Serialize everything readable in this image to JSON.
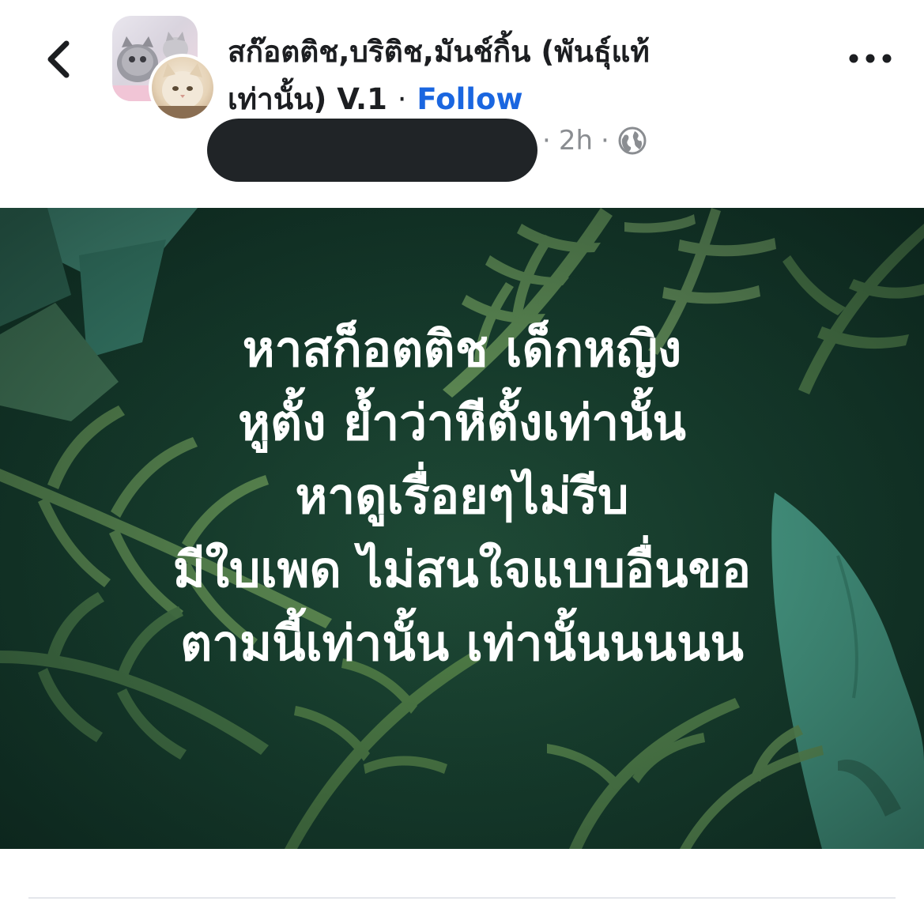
{
  "header": {
    "back_icon": "chevron-left-icon",
    "group_name": "สก๊อตติช,บริติช,มันช์กิ้น (พันธุ์แท้เท่านั้น) V.1",
    "separator": "·",
    "follow_label": "Follow",
    "more_icon": "more-horizontal-icon"
  },
  "post": {
    "time": "2h",
    "meta_separator": "·",
    "audience_icon": "globe-icon",
    "text_lines": [
      "หาสก็อตติช เด็กหญิง",
      "หูตั้ง ย้ำว่าหีตั้งเท่านั้น",
      "หาดูเรื่อยๆไม่รีบ",
      "มีใบเพด ไม่สนใจแบบอื่นขอ",
      "ตามนี้เท่านั้น เท่านั้นนนนน"
    ]
  },
  "colors": {
    "follow": "#1a66e0",
    "text": "#1c1e21",
    "meta": "#8a8d91",
    "post_background": "#153a2b",
    "leaf_light": "#6e9a5c",
    "leaf_dark": "#2f5e45",
    "leaf_teal": "#4fa893"
  }
}
